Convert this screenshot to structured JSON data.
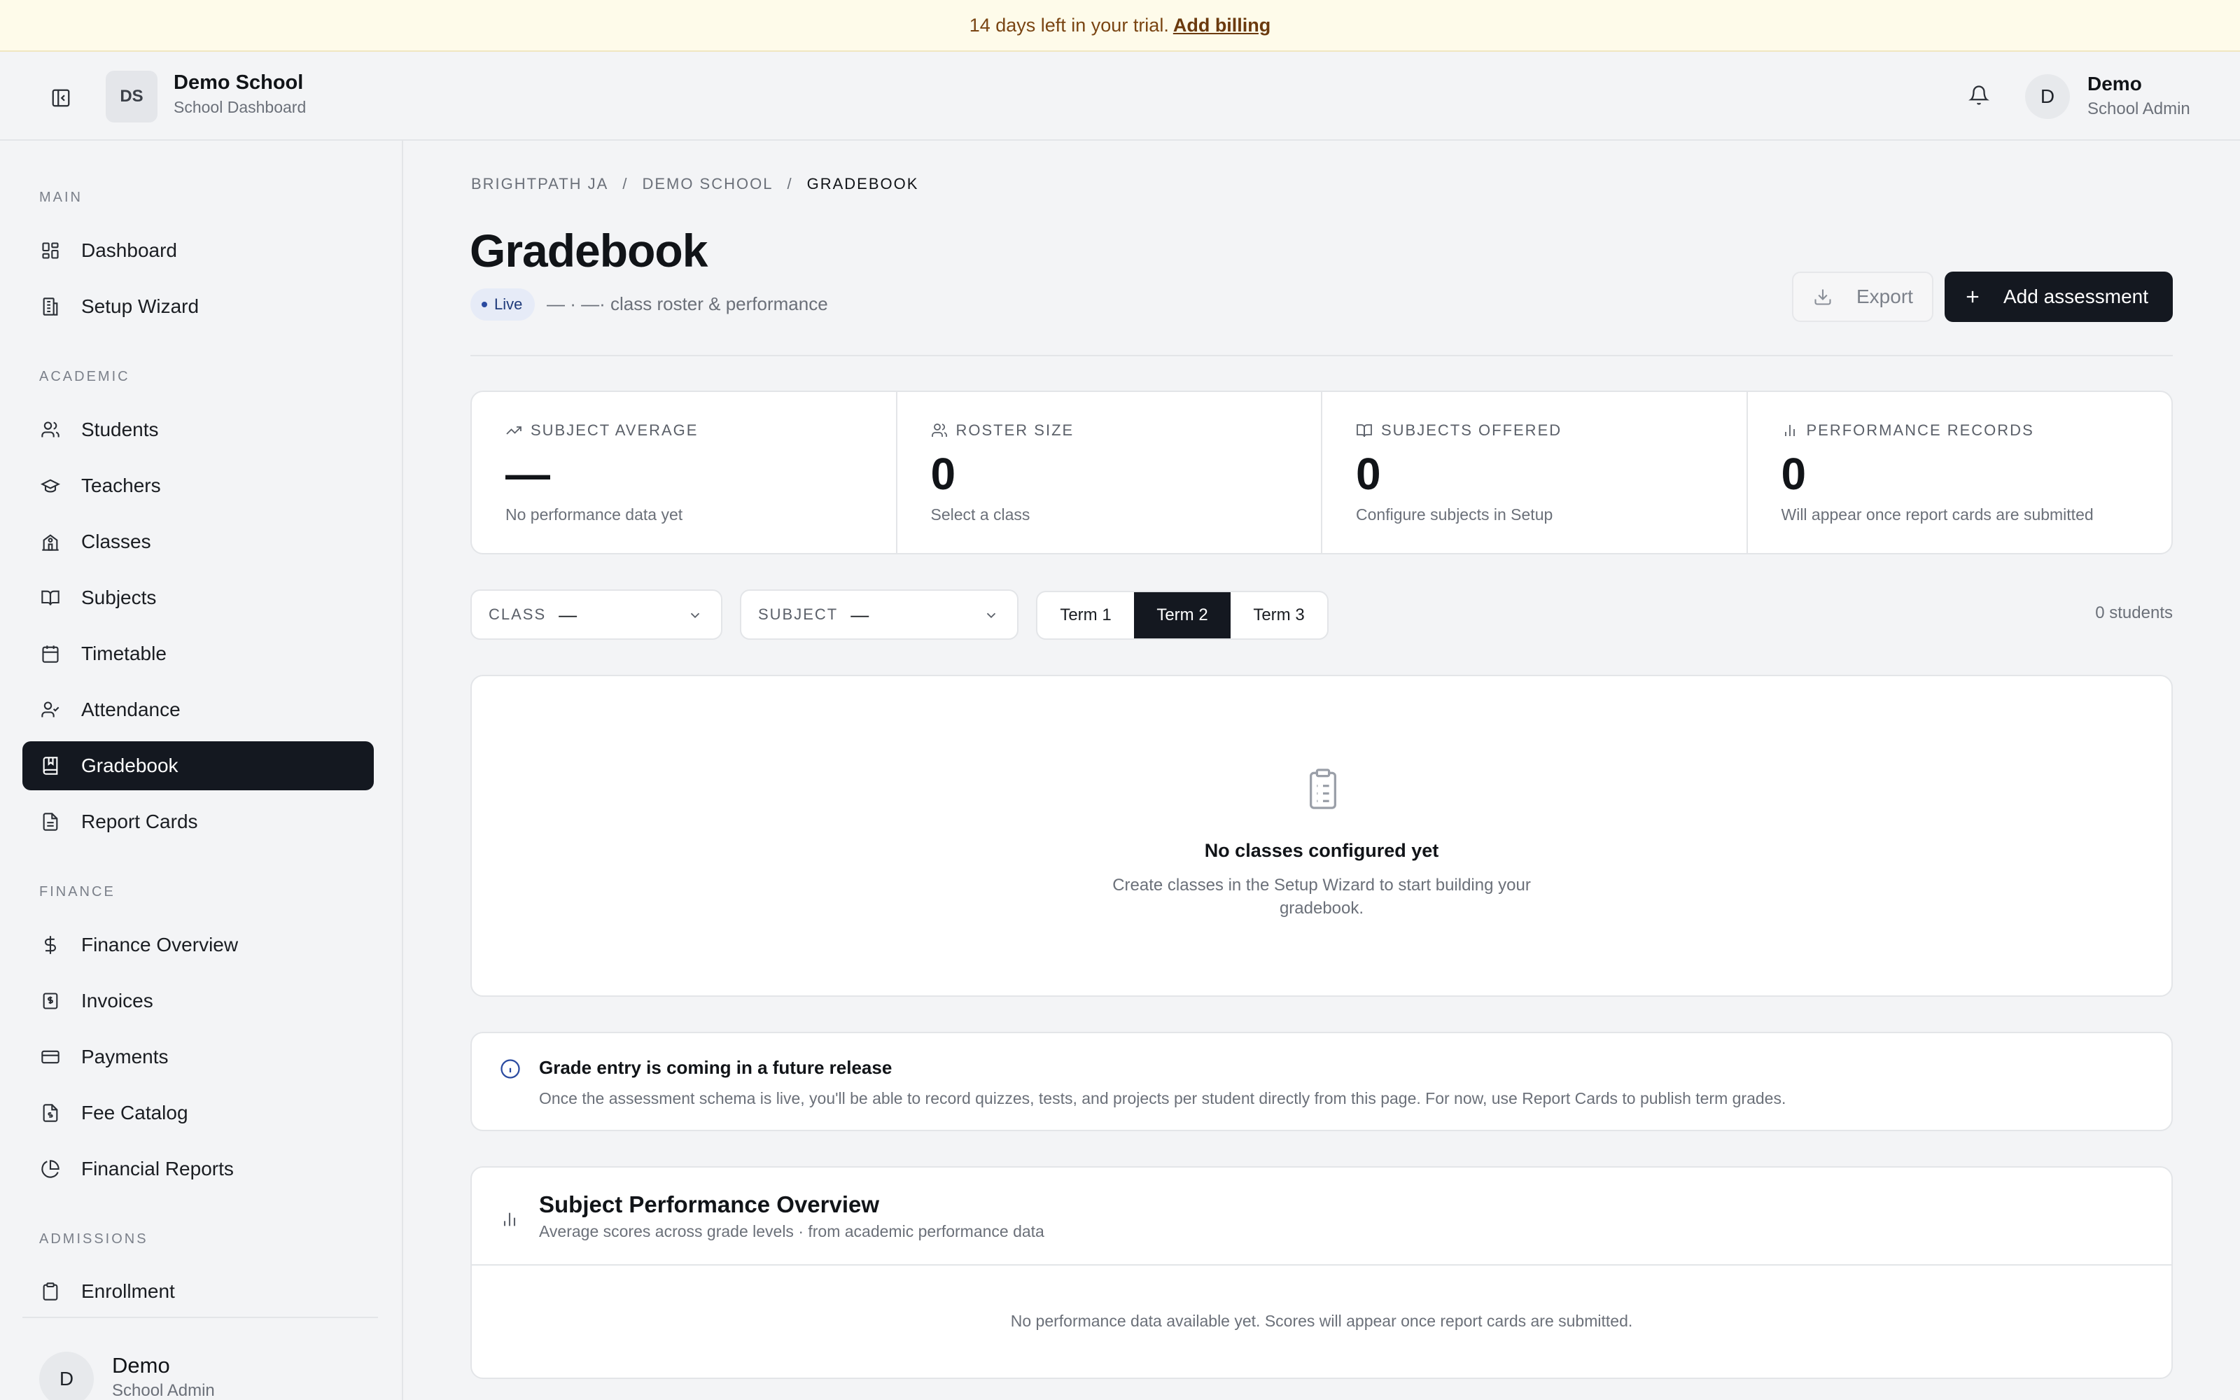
{
  "banner": {
    "text": "14 days left in your trial.",
    "link": "Add billing"
  },
  "header": {
    "school_initials": "DS",
    "school_name": "Demo School",
    "school_sub": "School Dashboard",
    "user_initial": "D",
    "user_name": "Demo",
    "user_role": "School Admin"
  },
  "sidebar": {
    "sections": [
      "MAIN",
      "ACADEMIC",
      "FINANCE",
      "ADMISSIONS"
    ],
    "items": [
      {
        "label": "Dashboard",
        "icon": "dashboard-icon"
      },
      {
        "label": "Setup Wizard",
        "icon": "building-icon"
      },
      {
        "label": "Students",
        "icon": "users-icon"
      },
      {
        "label": "Teachers",
        "icon": "graduation-cap-icon"
      },
      {
        "label": "Classes",
        "icon": "school-icon"
      },
      {
        "label": "Subjects",
        "icon": "book-open-icon"
      },
      {
        "label": "Timetable",
        "icon": "calendar-icon"
      },
      {
        "label": "Attendance",
        "icon": "user-check-icon"
      },
      {
        "label": "Gradebook",
        "icon": "book-marked-icon",
        "active": true
      },
      {
        "label": "Report Cards",
        "icon": "file-text-icon"
      },
      {
        "label": "Finance Overview",
        "icon": "dollar-icon"
      },
      {
        "label": "Invoices",
        "icon": "receipt-icon"
      },
      {
        "label": "Payments",
        "icon": "credit-card-icon"
      },
      {
        "label": "Fee Catalog",
        "icon": "file-list-icon"
      },
      {
        "label": "Financial Reports",
        "icon": "pie-chart-icon"
      },
      {
        "label": "Enrollment",
        "icon": "clipboard-icon"
      }
    ],
    "footer": {
      "initial": "D",
      "name": "Demo",
      "role": "School Admin"
    }
  },
  "breadcrumb": [
    "BRIGHTPATH JA",
    "DEMO SCHOOL",
    "GRADEBOOK"
  ],
  "page": {
    "title": "Gradebook",
    "badge": "Live",
    "subtitle": "— · —· class roster & performance",
    "export_label": "Export",
    "add_label": "Add assessment"
  },
  "stats": [
    {
      "label": "SUBJECT AVERAGE",
      "value": "—",
      "note": "No performance data yet",
      "icon": "trending-up-icon"
    },
    {
      "label": "ROSTER SIZE",
      "value": "0",
      "note": "Select a class",
      "icon": "users-icon"
    },
    {
      "label": "SUBJECTS OFFERED",
      "value": "0",
      "note": "Configure subjects in Setup",
      "icon": "book-open-icon"
    },
    {
      "label": "PERFORMANCE RECORDS",
      "value": "0",
      "note": "Will appear once report cards are submitted",
      "icon": "bar-chart-icon"
    }
  ],
  "filters": {
    "class_label": "CLASS",
    "class_value": "—",
    "subject_label": "SUBJECT",
    "subject_value": "—",
    "terms": [
      "Term 1",
      "Term 2",
      "Term 3"
    ],
    "active_term": "Term 2",
    "count": "0 students"
  },
  "empty": {
    "title": "No classes configured yet",
    "desc": "Create classes in the Setup Wizard to start building your gradebook."
  },
  "info": {
    "title": "Grade entry is coming in a future release",
    "desc": "Once the assessment schema is live, you'll be able to record quizzes, tests, and projects per student directly from this page. For now, use Report Cards to publish term grades."
  },
  "performance": {
    "title": "Subject Performance Overview",
    "sub": "Average scores across grade levels · from academic performance data",
    "empty": "No performance data available yet. Scores will appear once report cards are submitted."
  }
}
